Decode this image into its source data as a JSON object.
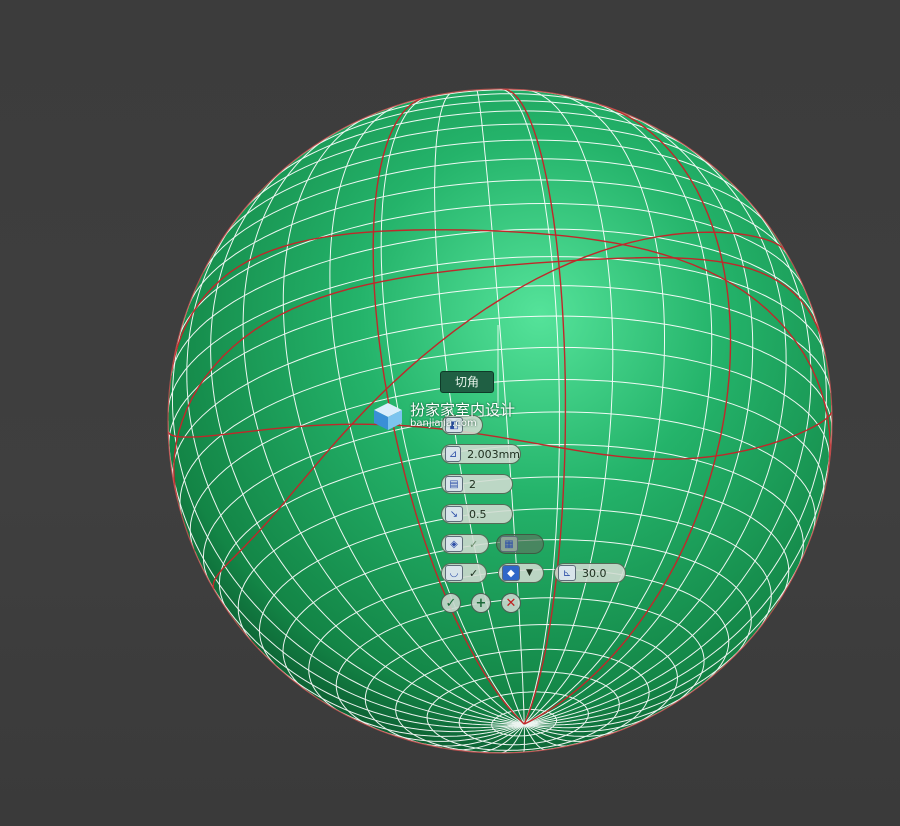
{
  "viewport": {
    "background": "#3d3d3d",
    "sphere_color": "#1e9a5a",
    "highlight_color": "#55e39a",
    "wire_color": "#ffffff",
    "edge_color": "#c0282a"
  },
  "caddy": {
    "title": "切角",
    "amount": "2.003mm",
    "segments": "2",
    "tension": "0.5",
    "threshold": "30.0",
    "ok_icon": "check-icon",
    "apply_icon": "plus-icon",
    "cancel_icon": "close-icon"
  },
  "watermark": {
    "text": "扮家家室内设计",
    "url": "banjiajia.com"
  }
}
